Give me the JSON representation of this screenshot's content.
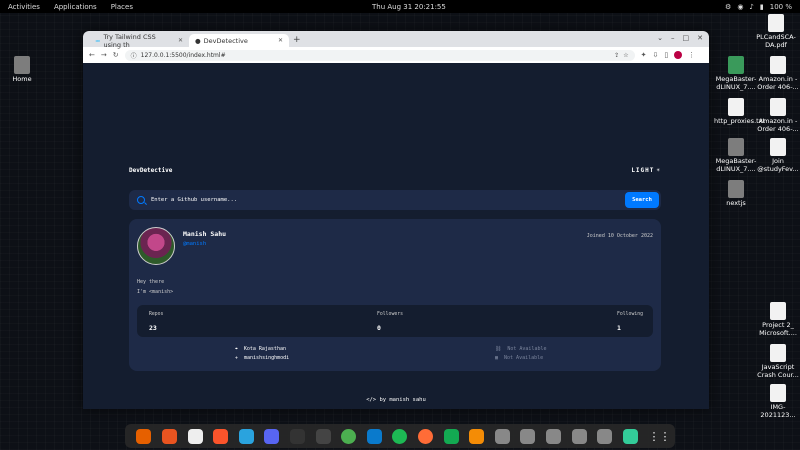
{
  "topbar": {
    "activities": "Activities",
    "applications": "Applications",
    "places": "Places",
    "clock": "Thu Aug 31  20:21:55",
    "battery": "100 %"
  },
  "desktop": {
    "home": "Home",
    "icons_right": [
      {
        "label": "PLCandSCA-DA.pdf",
        "kind": "file"
      },
      {
        "label": "MegaBaster-dLINUX_7....",
        "kind": "zip"
      },
      {
        "label": "Amazon.in - Order 406-...",
        "kind": "file"
      },
      {
        "label": "http_proxies.txt",
        "kind": "file"
      },
      {
        "label": "Amazon.in - Order 406-...",
        "kind": "file"
      },
      {
        "label": "MegaBaster-dLINUX_7....",
        "kind": "folder"
      },
      {
        "label": "Join @studyFev...",
        "kind": "file"
      },
      {
        "label": "nextjs",
        "kind": "folder"
      },
      {
        "label": "Project 2_ Microsoft....",
        "kind": "file"
      },
      {
        "label": "JavaScript Crash Cour...",
        "kind": "file"
      },
      {
        "label": "IMG-2021123...",
        "kind": "file"
      }
    ]
  },
  "browser": {
    "tabs": [
      {
        "title": "Try Tailwind CSS using th",
        "active": false
      },
      {
        "title": "DevDetective",
        "active": true
      }
    ],
    "url": "127.0.0.1:5500/index.html#"
  },
  "app": {
    "title": "DevDetective",
    "theme_label": "LIGHT",
    "search_placeholder": "Enter a Github username...",
    "search_button": "Search",
    "profile": {
      "name": "Manish Sahu",
      "login": "@manish",
      "joined": "Joined 10 October 2022",
      "bio_line1": "Hey there",
      "bio_line2": "I'm <manish>"
    },
    "stats": {
      "repos_label": "Repos",
      "repos_value": "23",
      "followers_label": "Followers",
      "followers_value": "0",
      "following_label": "Following",
      "following_value": "1"
    },
    "links": {
      "location": "Kota Rajasthan",
      "twitter": "manishsinghmodi",
      "website": "Not Available",
      "company": "Not Available"
    },
    "footer": "by manish sahu"
  },
  "colors": {
    "accent": "#0079ff",
    "page_bg": "#141d2f",
    "card_bg": "#1e2a47"
  }
}
